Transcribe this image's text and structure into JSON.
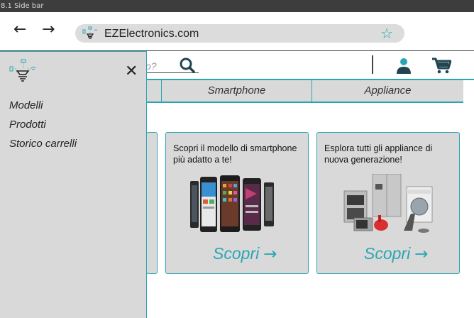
{
  "frame": {
    "label": "8.1 Side bar"
  },
  "browser": {
    "back_icon": "arrow-left-icon",
    "forward_icon": "arrow-right-icon",
    "url": "EZElectronics.com",
    "bookmark_icon": "star-icon"
  },
  "header": {
    "search_fragment": "o?",
    "search_icon": "magnifier-icon",
    "user_icon": "user-icon",
    "cart_icon": "cart-icon"
  },
  "categories": {
    "tabs": [
      {
        "label": "Smartphone"
      },
      {
        "label": "Appliance"
      }
    ]
  },
  "cards": [
    {
      "text": "Scopri il modello di smartphone più adatto a te!",
      "button": "Scopri",
      "image": "smartphones-image"
    },
    {
      "text": "Esplora tutti gli appliance di nuova generazione!",
      "button": "Scopri",
      "image": "appliances-image"
    }
  ],
  "sidebar": {
    "logo": "ezelectronics-logo",
    "close_icon": "close-icon",
    "items": [
      {
        "label": "Modelli"
      },
      {
        "label": "Prodotti"
      },
      {
        "label": "Storico carrelli"
      }
    ]
  },
  "colors": {
    "accent": "#2aa6b3",
    "panel": "#d9d9d9",
    "url_bar": "#dcdcdc",
    "frame_bar": "#3d3d3d"
  }
}
